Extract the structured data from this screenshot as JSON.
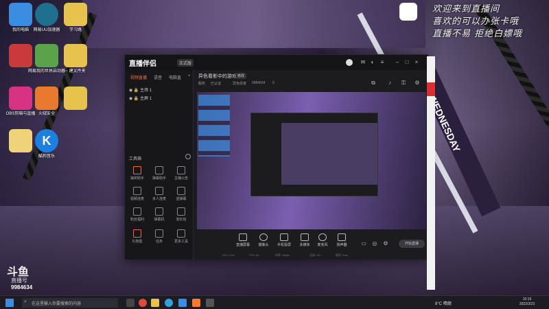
{
  "desktop": {
    "icons": [
      {
        "label": "我的电脑",
        "color": "#3a8de0"
      },
      {
        "label": "网易UU加速器",
        "color": "#1f6f8f"
      },
      {
        "label": "学习路",
        "color": "#e6c24f"
      },
      {
        "label": "",
        "color": "#c93b3b"
      },
      {
        "label": "网易我的世界启动器",
        "color": "#5aa34a"
      },
      {
        "label": "~ 建文件夹",
        "color": "#e6c24f"
      },
      {
        "label": "OBS剪辑与直播",
        "color": "#d63384"
      },
      {
        "label": "火绒安全",
        "color": "#e8792f"
      },
      {
        "label": "",
        "color": "#e6c24f"
      },
      {
        "label": "",
        "color": "#f0d27a"
      },
      {
        "label": "酷狗音乐",
        "color": "#1d7fe0"
      }
    ]
  },
  "overlay": {
    "lines": [
      "欢迎来到直播间",
      "喜欢的可以办张卡哦",
      "直播不易 拒绝白嫖哦"
    ],
    "banner_text": "2022 - WEDNESDAY",
    "douyu_logo": "斗鱼",
    "douyu_sub": "直播号",
    "room_number": "9984634"
  },
  "app": {
    "brand": "直播伴侣",
    "brand_tag": "正式版",
    "tabs": [
      "视频直播",
      "语音",
      "电脑直"
    ],
    "scenes": [
      "主场 1",
      "主屏 1"
    ],
    "tools_section": "工具箱",
    "tools": [
      "抽奖助手",
      "弹幕助手",
      "主播公告",
      "视频连麦",
      "多人连麦",
      "送弹幕",
      "粉丝福利",
      "弹幕机",
      "发红包",
      "礼物盒",
      "任务",
      "更多工具"
    ],
    "room_title": "异色看影中的游戏",
    "room_badge": "修改",
    "room_meta": [
      "服务",
      "已认证",
      "异色恩者",
      "9984634",
      "0"
    ],
    "bottom_tools": [
      "直播屏幕",
      "摄像头",
      "手机投屏",
      "多媒体",
      "麦克风",
      "扬声器"
    ],
    "start_button": "开始直播",
    "status": [
      "CPU: 12%",
      "FPS: 30",
      "码率: 0kbps",
      "丢帧: 0%",
      "帧时: 0ms"
    ]
  },
  "taskbar": {
    "search_placeholder": "在这里输入你要搜索的内容",
    "weather": "8°C 晴朗",
    "time": "10:19",
    "date": "2022/3/23"
  }
}
